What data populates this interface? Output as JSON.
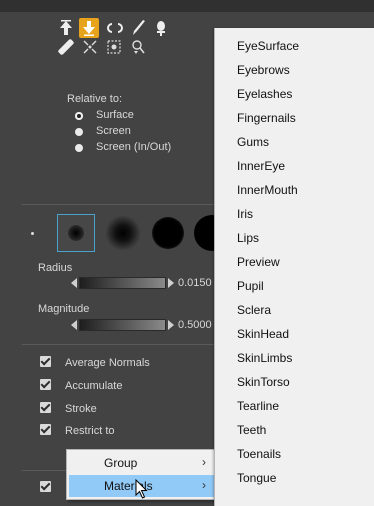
{
  "colors": {
    "panel_bg": "#434343",
    "active_tool": "#e7a31b",
    "menu_bg": "#f0f0f0",
    "menu_highlight": "#91c9f7"
  },
  "tools": {
    "row1": [
      "move-up-icon",
      "move-down-icon",
      "rotate-icon",
      "brush-icon",
      "push-pin-icon"
    ],
    "row2": [
      "bandage-icon",
      "scatter-icon",
      "frame-select-icon",
      "pose-icon"
    ]
  },
  "relative": {
    "heading": "Relative to:",
    "options": [
      "Surface",
      "Screen",
      "Screen (In/Out)"
    ],
    "selected": "Surface"
  },
  "radius": {
    "label": "Radius",
    "value": "0.0150"
  },
  "magnitude": {
    "label": "Magnitude",
    "value": "0.5000"
  },
  "options": {
    "average_normals": "Average Normals",
    "accumulate": "Accumulate",
    "stroke": "Stroke",
    "restrict_to": "Restrict to"
  },
  "context_menu": {
    "items": [
      {
        "label": "Group",
        "arrow": "›"
      },
      {
        "label": "Materials",
        "arrow": "›"
      }
    ],
    "highlighted": "Materials"
  },
  "submenu": {
    "items": [
      "EyeSurface",
      "Eyebrows",
      "Eyelashes",
      "Fingernails",
      "Gums",
      "InnerEye",
      "InnerMouth",
      "Iris",
      "Lips",
      "Preview",
      "Pupil",
      "Sclera",
      "SkinHead",
      "SkinLimbs",
      "SkinTorso",
      "Tearline",
      "Teeth",
      "Toenails",
      "Tongue"
    ]
  }
}
